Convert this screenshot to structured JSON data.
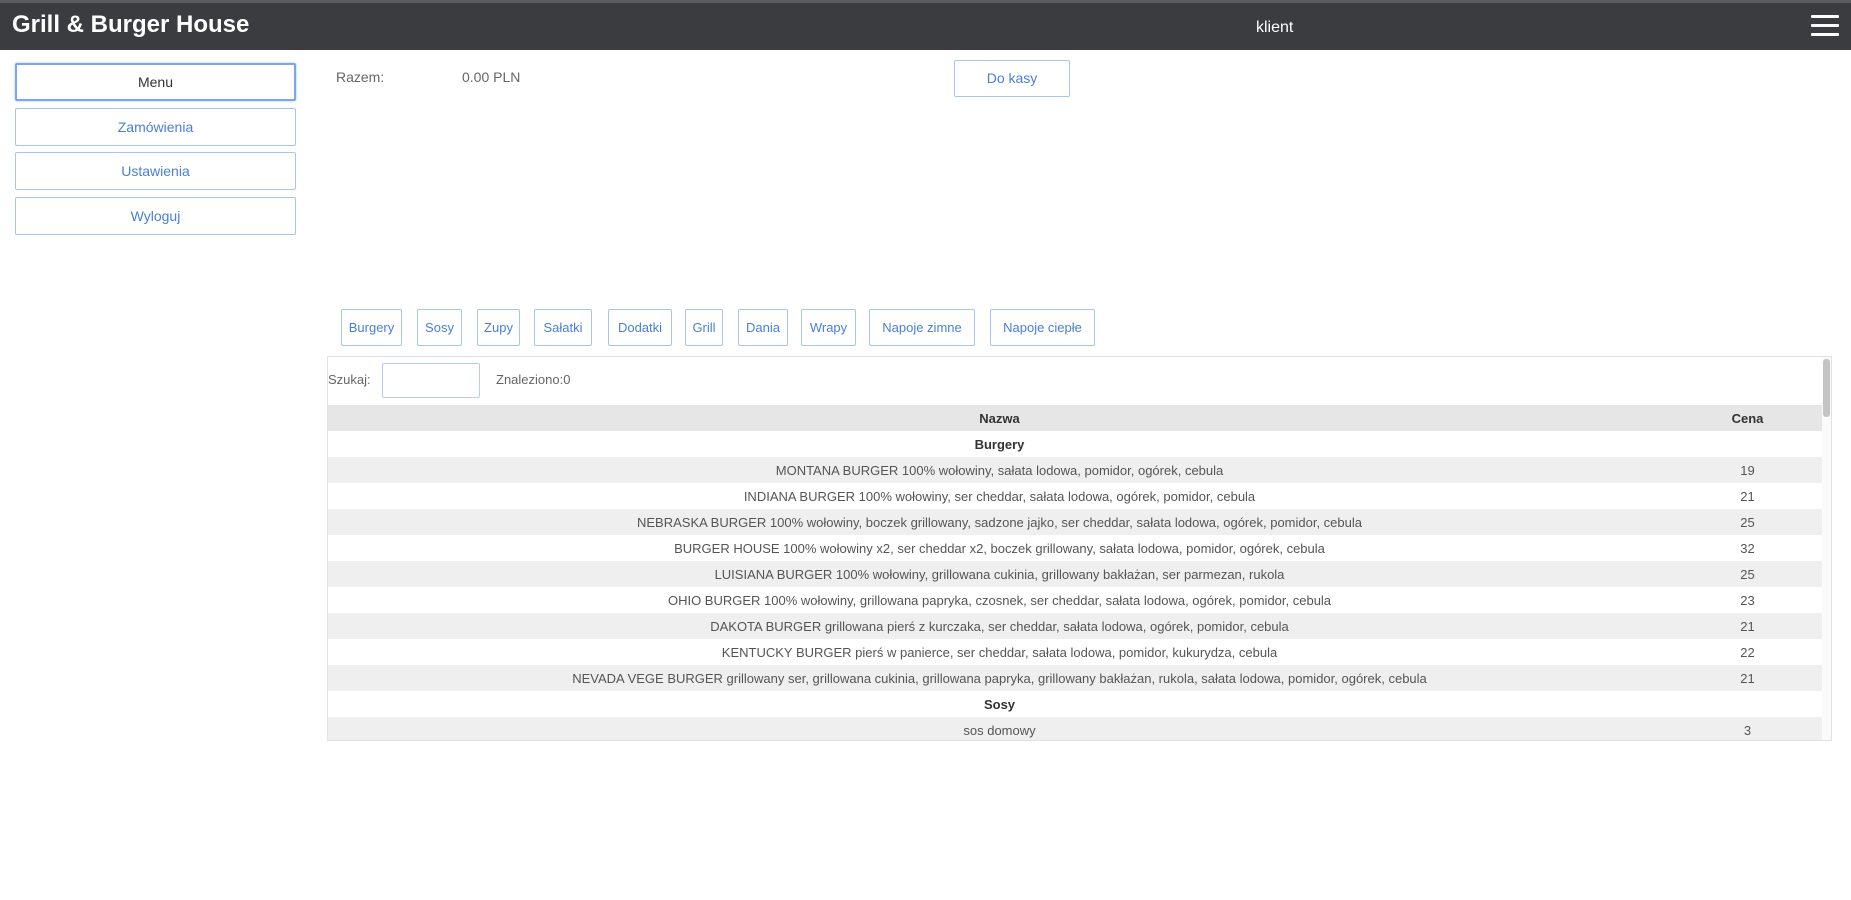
{
  "header": {
    "title": "Grill & Burger House",
    "user": "klient",
    "menu_icon": "hamburger-menu-icon"
  },
  "sidebar": {
    "items": [
      {
        "label": "Menu",
        "active": true
      },
      {
        "label": "Zamówienia"
      },
      {
        "label": "Ustawienia"
      },
      {
        "label": "Wyloguj"
      }
    ]
  },
  "cart": {
    "total_label": "Razem:",
    "total_value": "0.00 PLN",
    "checkout_label": "Do kasy"
  },
  "categories": [
    "Burgery",
    "Sosy",
    "Zupy",
    "Sałatki",
    "Dodatki",
    "Grill",
    "Dania",
    "Wrapy",
    "Napoje zimne",
    "Napoje ciepłe"
  ],
  "search": {
    "label": "Szukaj:",
    "value": "",
    "found_label": "Znaleziono:0"
  },
  "table": {
    "headers": {
      "name": "Nazwa",
      "price": "Cena"
    },
    "rows": [
      {
        "category": "Burgery"
      },
      {
        "name": "MONTANA BURGER 100% wołowiny, sałata lodowa, pomidor, ogórek, cebula",
        "price": "19"
      },
      {
        "name": "INDIANA BURGER 100% wołowiny, ser cheddar, sałata lodowa, ogórek, pomidor, cebula",
        "price": "21"
      },
      {
        "name": "NEBRASKA BURGER 100% wołowiny, boczek grillowany, sadzone jajko, ser cheddar, sałata lodowa, ogórek, pomidor, cebula",
        "price": "25"
      },
      {
        "name": "BURGER HOUSE 100% wołowiny x2, ser cheddar x2, boczek grillowany, sałata lodowa, pomidor, ogórek, cebula",
        "price": "32"
      },
      {
        "name": "LUISIANA BURGER 100% wołowiny, grillowana cukinia, grillowany bakłażan, ser parmezan, rukola",
        "price": "25"
      },
      {
        "name": "OHIO BURGER 100% wołowiny, grillowana papryka, czosnek, ser cheddar, sałata lodowa, ogórek, pomidor, cebula",
        "price": "23"
      },
      {
        "name": "DAKOTA BURGER grillowana pierś z kurczaka, ser cheddar, sałata lodowa, ogórek, pomidor, cebula",
        "price": "21"
      },
      {
        "name": "KENTUCKY BURGER pierś w panierce, ser cheddar, sałata lodowa, pomidor, kukurydza, cebula",
        "price": "22"
      },
      {
        "name": "NEVADA VEGE BURGER grillowany ser, grillowana cukinia, grillowana papryka, grillowany bakłażan, rukola, sałata lodowa, pomidor, ogórek, cebula",
        "price": "21"
      },
      {
        "category": "Sosy"
      },
      {
        "name": "sos domowy",
        "price": "3"
      }
    ]
  }
}
